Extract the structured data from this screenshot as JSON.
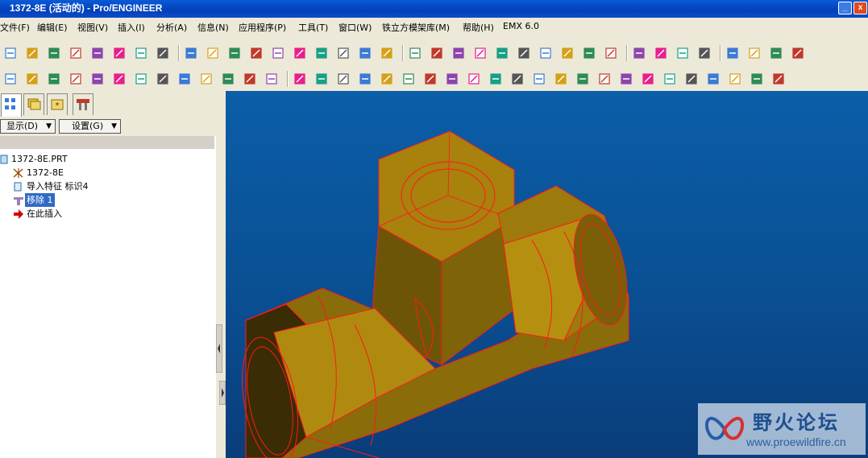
{
  "window": {
    "title": "1372-8E (活动的) - Pro/ENGINEER",
    "min_glyph": "_",
    "close_glyph": "x"
  },
  "menubar": {
    "items": [
      "文件(F)",
      "编辑(E)",
      "视图(V)",
      "插入(I)",
      "分析(A)",
      "信息(N)",
      "应用程序(P)",
      "工具(T)",
      "窗口(W)",
      "铁立方模架库(M)",
      "帮助(H)",
      "EMX 6.0"
    ]
  },
  "toolbar_row1": {
    "icons": [
      "new-file-icon",
      "open-folder-icon",
      "save-icon",
      "save-copy-icon",
      "edit-icon",
      "print-icon",
      "send-mail-icon",
      "refresh-icon",
      "undo-icon",
      "redo-icon",
      "cut-icon",
      "copy-icon",
      "paste-icon",
      "paste-special-icon",
      "regenerate-icon",
      "find-icon",
      "select-box-icon",
      "dropdown-arrow-icon",
      "repaint-icon",
      "spin-center-icon",
      "orient-mode-icon",
      "zoom-in-icon",
      "zoom-out-icon",
      "refit-icon",
      "reorient-icon",
      "saved-views-icon",
      "layers-icon",
      "view-manager-icon",
      "wireframe-icon",
      "hidden-line-icon",
      "no-hidden-icon",
      "shading-icon",
      "datum-planes-icon",
      "datum-axes-icon",
      "datum-points-icon",
      "csys-icon"
    ]
  },
  "toolbar_row2": {
    "icons": [
      "sketch-tool-icon",
      "surface-tool-icon",
      "style-tool-icon",
      "pencil-icon",
      "datum-curve-icon",
      "boundary-blend-icon",
      "wave-icon",
      "wave2-icon",
      "wave3-icon",
      "revolve-surface-icon",
      "patch-icon",
      "delete-icon",
      "help-pointer-icon",
      "extrude-icon",
      "revolve-icon",
      "sweep-icon",
      "blend-icon",
      "hole-icon",
      "round-icon",
      "chamfer-icon",
      "rib-icon",
      "draft-icon",
      "shell-icon",
      "pattern-icon",
      "mirror-icon",
      "merge-icon",
      "trim-icon",
      "extend-icon",
      "offset-icon",
      "thicken-icon",
      "solidify-icon",
      "intersect-icon",
      "project-icon",
      "wrap-icon",
      "flatten-icon",
      "split-icon"
    ]
  },
  "left_panel": {
    "tabs": [
      "model-tree-tab",
      "layer-tree-tab",
      "favorites-tab",
      "settings-tab"
    ],
    "show_button": "显示(D)",
    "settings_button": "设置(G)",
    "tree": [
      {
        "label": "1372-8E.PRT",
        "icon": "part-icon",
        "indent": 0,
        "selected": false
      },
      {
        "label": "1372-8E",
        "icon": "csys-feature-icon",
        "indent": 1,
        "selected": false
      },
      {
        "label": "导入特征 标识4",
        "icon": "import-feature-icon",
        "indent": 1,
        "selected": false
      },
      {
        "label": "移除 1",
        "icon": "remove-feature-icon",
        "indent": 1,
        "selected": true
      },
      {
        "label": "在此插入",
        "icon": "insert-here-arrow-icon",
        "indent": 1,
        "selected": false
      }
    ]
  },
  "graphics": {
    "background": "#0a4f93",
    "model_color": "#b8860b",
    "edge_color": "#ff0000"
  },
  "watermark": {
    "title": "野火论坛",
    "url": "www.proewildfire.cn"
  },
  "colors": {
    "titlebar": "#0a5ad8",
    "selection": "#316ac5",
    "chrome": "#ece9d8"
  }
}
